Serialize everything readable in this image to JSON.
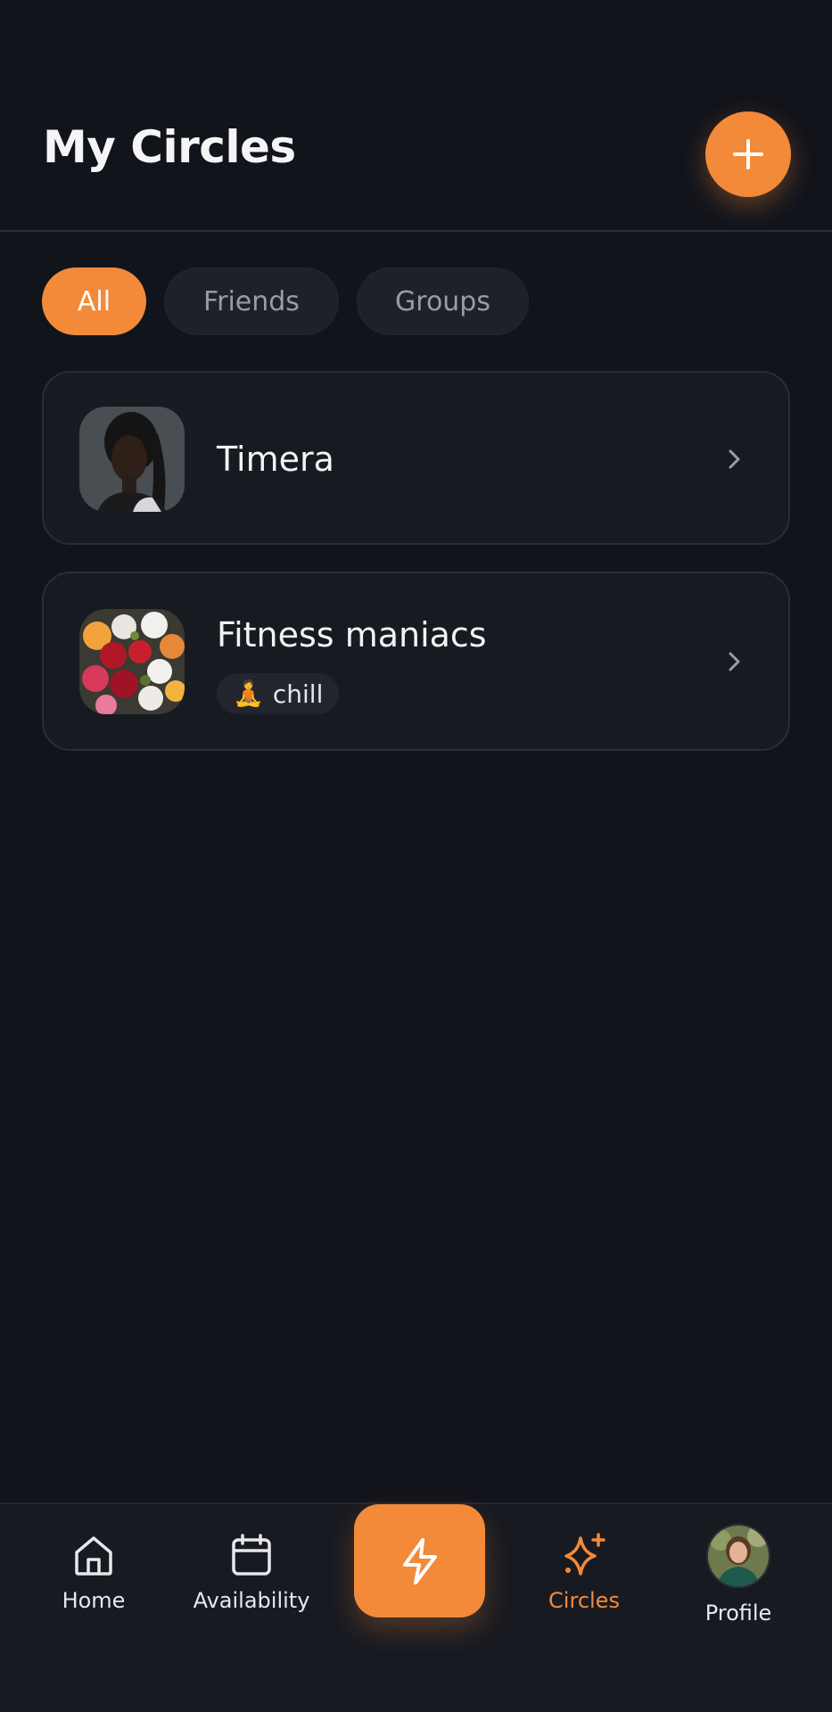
{
  "header": {
    "title": "My Circles",
    "add_icon": "plus-icon"
  },
  "filters": {
    "items": [
      {
        "label": "All",
        "active": true
      },
      {
        "label": "Friends",
        "active": false
      },
      {
        "label": "Groups",
        "active": false
      }
    ]
  },
  "circles": [
    {
      "name": "Timera",
      "avatar": "person-photo"
    },
    {
      "name": "Fitness maniacs",
      "avatar": "flowers-photo",
      "tag": {
        "emoji": "🧘",
        "label": "chill"
      }
    }
  ],
  "nav": {
    "items": [
      {
        "label": "Home",
        "icon": "home-icon",
        "active": false
      },
      {
        "label": "Availability",
        "icon": "calendar-icon",
        "active": false
      },
      {
        "label": "",
        "icon": "lightning-icon",
        "active": false
      },
      {
        "label": "Circles",
        "icon": "sparkles-icon",
        "active": true
      },
      {
        "label": "Profile",
        "icon": "profile-avatar",
        "active": false
      }
    ]
  },
  "colors": {
    "background": "#12141b",
    "card": "#181a21",
    "accent": "#f28a3a",
    "muted_text": "#9a9ca3",
    "border": "#2a2d35"
  }
}
